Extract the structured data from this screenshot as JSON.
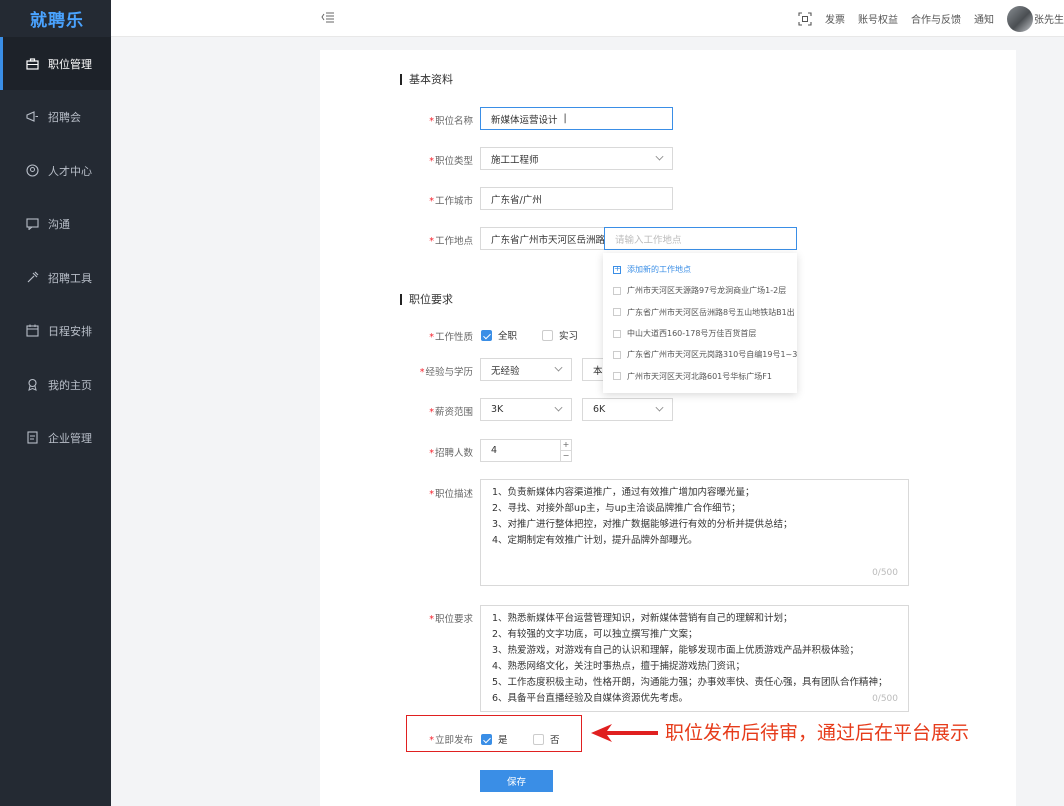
{
  "app": {
    "logo": "就聘乐"
  },
  "sidebar": {
    "items": [
      {
        "label": "职位管理",
        "icon": "briefcase-icon",
        "active": true
      },
      {
        "label": "招聘会",
        "icon": "megaphone-icon"
      },
      {
        "label": "人才中心",
        "icon": "user-circle-icon"
      },
      {
        "label": "沟通",
        "icon": "chat-icon"
      },
      {
        "label": "招聘工具",
        "icon": "tools-icon"
      },
      {
        "label": "日程安排",
        "icon": "calendar-icon"
      },
      {
        "label": "我的主页",
        "icon": "badge-icon"
      },
      {
        "label": "企业管理",
        "icon": "document-icon"
      }
    ]
  },
  "topbar": {
    "links": [
      "发票",
      "账号权益",
      "合作与反馈",
      "通知"
    ],
    "username": "张先生"
  },
  "form": {
    "basic_title": "基本资料",
    "job_name": {
      "label": "职位名称",
      "value": "新媒体运营设计"
    },
    "job_type": {
      "label": "职位类型",
      "value": "施工工程师"
    },
    "city": {
      "label": "工作城市",
      "value": "广东省/广州"
    },
    "address": {
      "label": "工作地点",
      "value": "广东省广州市天河区岳洲路",
      "placeholder": "请输入工作地点"
    },
    "address_dropdown": {
      "add_label": "添加新的工作地点",
      "options": [
        "广州市天河区天源路97号龙洞商业广场1-2层",
        "广东省广州市天河区岳洲路8号五山地铁站B1出",
        "中山大道西160-178号万佳百货首层",
        "广东省广州市天河区元岗路310号自编19号1~3",
        "广州市天河区天河北路601号华标广场F1"
      ]
    },
    "req_title": "职位要求",
    "job_nature": {
      "label": "工作性质",
      "options": [
        "全职",
        "实习"
      ],
      "selected": "全职"
    },
    "exp_edu": {
      "label": "经验与学历",
      "experience": "无经验",
      "education": "本"
    },
    "salary": {
      "label": "薪资范围",
      "min": "3K",
      "max": "6K"
    },
    "headcount": {
      "label": "招聘人数",
      "value": "4",
      "plus": "+",
      "minus": "−"
    },
    "description": {
      "label": "职位描述",
      "lines": [
        "1、负责新媒体内容渠道推广，通过有效推广增加内容曝光量；",
        "2、寻找、对接外部up主，与up主洽谈品牌推广合作细节；",
        "3、对推广进行整体把控，对推广数据能够进行有效的分析并提供总结；",
        "4、定期制定有效推广计划，提升品牌外部曝光。"
      ],
      "count": "0/500"
    },
    "requirement": {
      "label": "职位要求",
      "lines": [
        "1、熟悉新媒体平台运营管理知识，对新媒体营销有自己的理解和计划；",
        "2、有较强的文字功底，可以独立撰写推广文案；",
        "3、热爱游戏，对游戏有自己的认识和理解，能够发现市面上优质游戏产品并积极体验；",
        "4、熟悉网络文化，关注时事热点，擅于捕捉游戏热门资讯；",
        "5、工作态度积极主动，性格开朗，沟通能力强；办事效率快、责任心强，具有团队合作精神；",
        "6、具备平台直播经验及自媒体资源优先考虑。"
      ],
      "count": "0/500"
    },
    "publish": {
      "label": "立即发布",
      "yes": "是",
      "no": "否",
      "selected": "是"
    },
    "save_label": "保存",
    "required_mark": "*"
  },
  "annotation": {
    "text": "职位发布后待审，通过后在平台展示",
    "color": "#e63b1a"
  }
}
